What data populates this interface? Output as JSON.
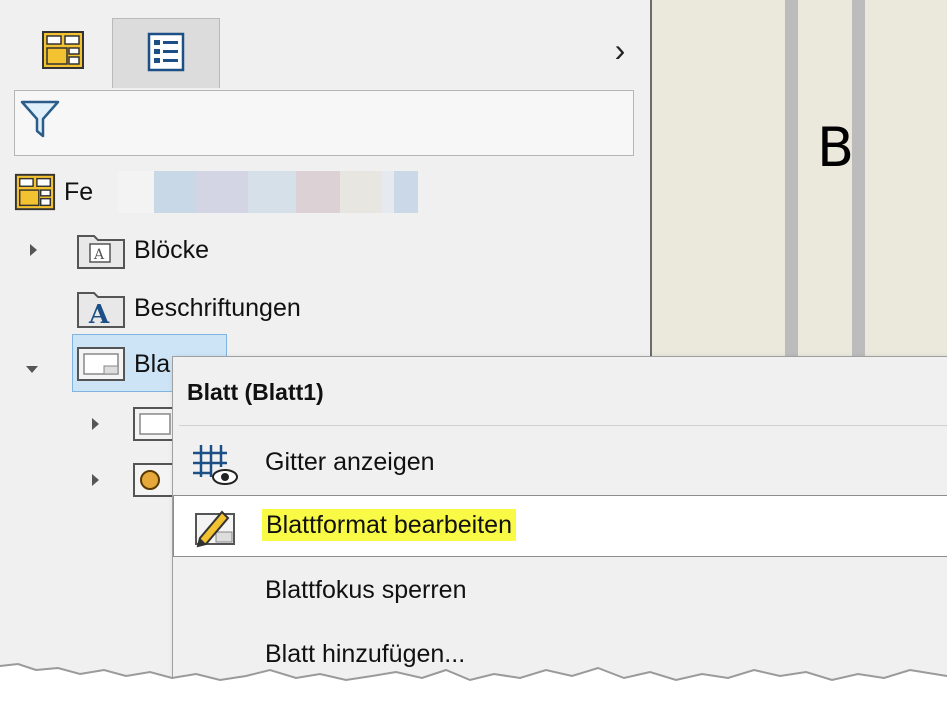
{
  "tree": {
    "root_label": "Fe",
    "items": [
      {
        "label": "Blöcke"
      },
      {
        "label": "Beschriftungen"
      },
      {
        "label": "Bla"
      }
    ]
  },
  "drawing": {
    "letter": "B"
  },
  "context_menu": {
    "title": "Blatt (Blatt1)",
    "items": [
      {
        "label": "Gitter anzeigen",
        "icon": "grid-eye-icon"
      },
      {
        "label": "Blattformat bearbeiten",
        "icon": "edit-sheet-format-icon",
        "highlight": "#f9fa46"
      },
      {
        "label": "Blattfokus sperren"
      },
      {
        "label": "Blatt hinzufügen..."
      }
    ]
  },
  "blur_colors": [
    "#f3f3f3",
    "#c9d8e6",
    "#d3d5e5",
    "#d6e0e8",
    "#dcd2d6",
    "#e8e6e1",
    "#e6eaf0",
    "#cad8e8"
  ],
  "colors": {
    "panel": "#f0f0f0",
    "selection": "#cde4f7",
    "drawing_bg": "#ebe8dc",
    "highlight": "#f9fa46"
  }
}
